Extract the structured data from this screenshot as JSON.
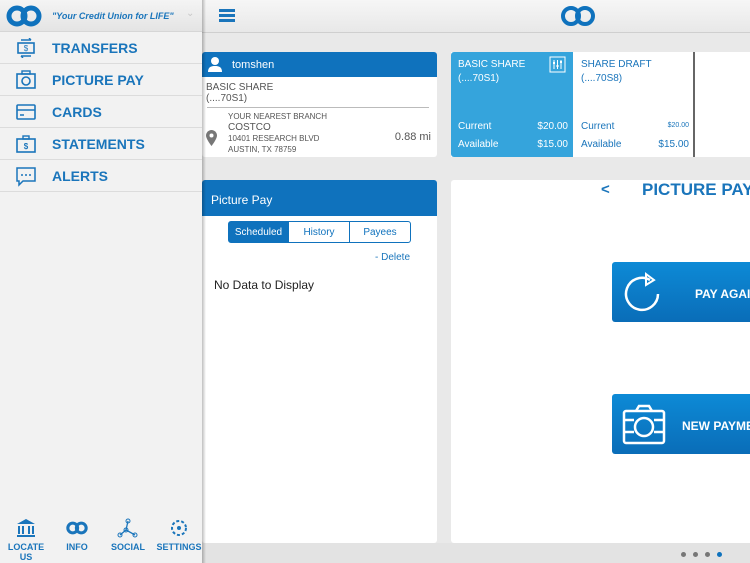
{
  "sidebar": {
    "tagline": "\"Your Credit Union for LIFE\"",
    "menu": [
      {
        "label": "TRANSFERS",
        "icon": "transfer-icon"
      },
      {
        "label": "PICTURE PAY",
        "icon": "camera-icon"
      },
      {
        "label": "CARDS",
        "icon": "card-icon"
      },
      {
        "label": "STATEMENTS",
        "icon": "statement-icon"
      },
      {
        "label": "ALERTS",
        "icon": "chat-icon"
      }
    ],
    "footer": [
      {
        "label": "LOCATE US",
        "icon": "bank-icon"
      },
      {
        "label": "INFO",
        "icon": "logo-icon"
      },
      {
        "label": "SOCIAL",
        "icon": "share-icon"
      },
      {
        "label": "SETTINGS",
        "icon": "gear-icon"
      }
    ]
  },
  "profile": {
    "username": "tomshen",
    "account_name": "BASIC SHARE",
    "account_num": "(....70S1)",
    "branch_label": "YOUR NEAREST BRANCH",
    "branch_name": "COSTCO",
    "address1": "10401 RESEARCH BLVD",
    "address2": "AUSTIN, TX 78759",
    "distance": "0.88 mi"
  },
  "accounts": [
    {
      "name": "BASIC SHARE",
      "num": "(....70S1)",
      "current_label": "Current",
      "current": "$20.00",
      "available_label": "Available",
      "available": "$15.00"
    },
    {
      "name": "SHARE DRAFT",
      "num": "(....70S8)",
      "current_label": "Current",
      "current": "$20.00",
      "available_label": "Available",
      "available": "$15.00"
    }
  ],
  "picture_pay": {
    "title": "Picture Pay",
    "tabs": [
      "Scheduled",
      "History",
      "Payees"
    ],
    "active_tab": 0,
    "delete": "- Delete",
    "empty": "No Data to Display"
  },
  "right_panel": {
    "back": "<",
    "title": "PICTURE PAY",
    "pay_again": "PAY AGAIN",
    "new_payment": "NEW PAYMENT"
  },
  "pager": {
    "pages": 4,
    "active": 3
  },
  "colors": {
    "brand": "#0f72bd",
    "tile_active": "#35a4dc"
  }
}
